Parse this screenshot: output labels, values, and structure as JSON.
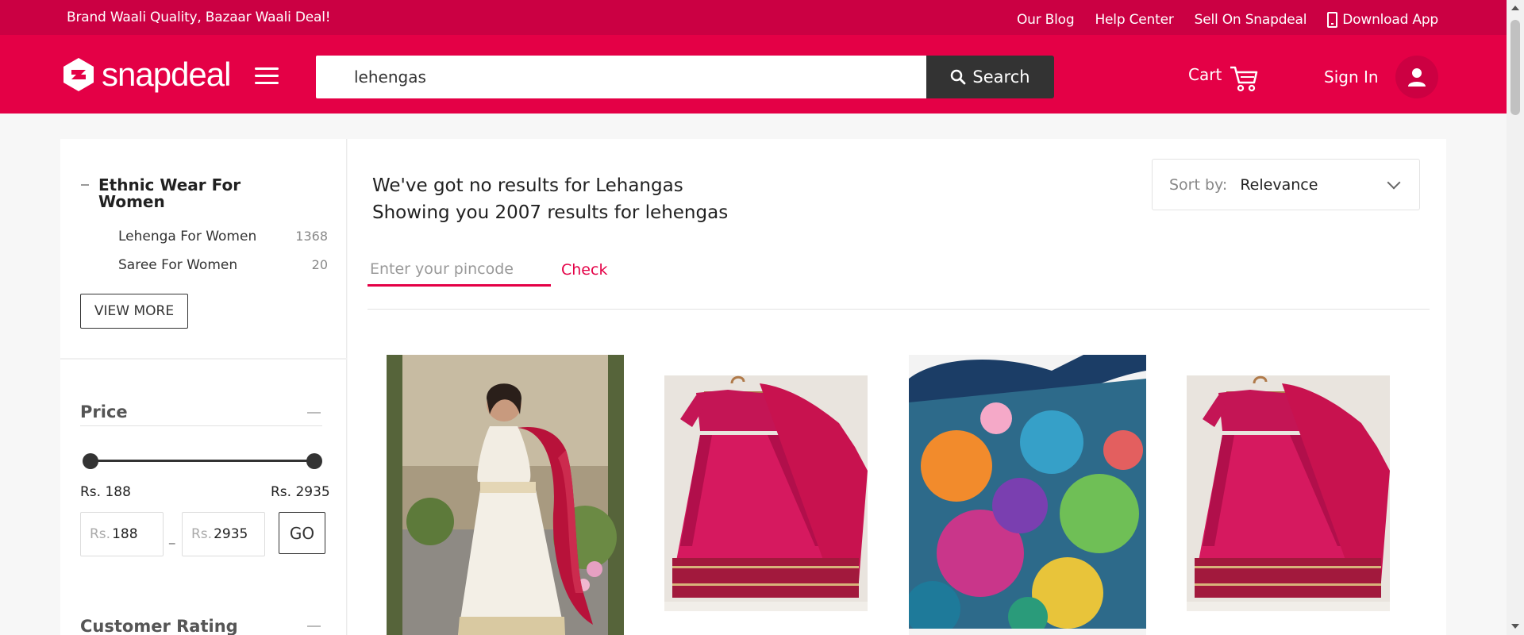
{
  "top_strip": {
    "tagline": "Brand Waali Quality, Bazaar Waali Deal!",
    "links": [
      "Our Blog",
      "Help Center",
      "Sell On Snapdeal",
      "Download App"
    ]
  },
  "header": {
    "logo_text": "snapdeal",
    "search_value": "lehengas",
    "search_button": "Search",
    "cart_label": "Cart",
    "signin_label": "Sign In"
  },
  "sidebar": {
    "category_title": "Ethnic Wear For Women",
    "subcategories": [
      {
        "label": "Lehenga For Women",
        "count": "1368"
      },
      {
        "label": "Saree For Women",
        "count": "20"
      }
    ],
    "view_more": "VIEW MORE",
    "price": {
      "title": "Price",
      "min_label": "Rs. 188",
      "max_label": "Rs. 2935",
      "currency": "Rs.",
      "min_value": "188",
      "max_value": "2935",
      "dash": "_",
      "go_label": "GO"
    },
    "rating_title": "Customer Rating"
  },
  "results": {
    "line1": "We've got no results for Lehangas",
    "line2": "Showing you 2007 results for lehengas"
  },
  "sort": {
    "label": "Sort by:",
    "value": "Relevance"
  },
  "pincode": {
    "placeholder": "Enter your pincode",
    "check_label": "Check"
  },
  "colors": {
    "brand_dark": "#cb0043",
    "brand": "#e40046",
    "search_button": "#333333"
  },
  "icons": [
    "logo-bag-icon",
    "hamburger-icon",
    "search-icon",
    "cart-icon",
    "user-icon",
    "phone-icon",
    "chevron-down-icon"
  ]
}
